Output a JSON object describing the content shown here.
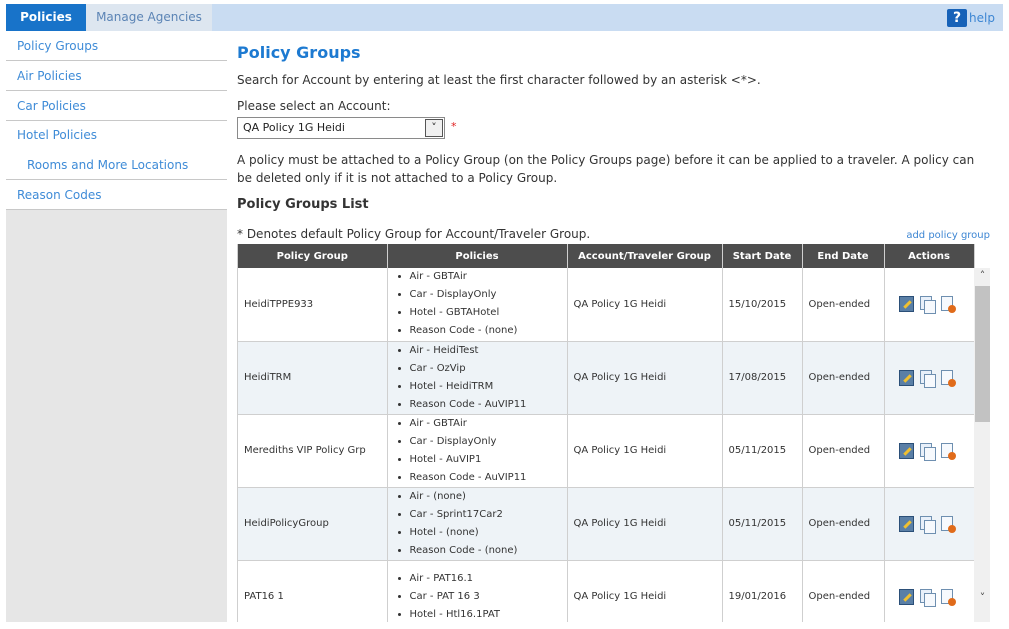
{
  "tabs": {
    "policies": "Policies",
    "manage_agencies": "Manage Agencies"
  },
  "help": {
    "label": "help",
    "icon": "?"
  },
  "sidebar": {
    "items": [
      {
        "label": "Policy Groups"
      },
      {
        "label": "Air Policies"
      },
      {
        "label": "Car Policies"
      },
      {
        "label": "Hotel Policies"
      },
      {
        "label": "Rooms and More Locations"
      },
      {
        "label": "Reason Codes"
      }
    ]
  },
  "main": {
    "title": "Policy Groups",
    "search_hint": "Search for Account by entering at least the first character followed by an asterisk <*>.",
    "account_label": "Please select an Account:",
    "account_value": "QA Policy 1G Heidi",
    "required_marker": "*",
    "policy_note": "A policy must be attached to a Policy Group (on the Policy Groups page) before it can be applied to a traveler. A policy can be deleted only if it is not attached to a Policy Group.",
    "list_title": "Policy Groups List",
    "default_note": "* Denotes default Policy Group for Account/Traveler Group.",
    "add_link": "add policy group"
  },
  "table": {
    "headers": [
      "Policy Group",
      "Policies",
      "Account/Traveler Group",
      "Start Date",
      "End Date",
      "Actions"
    ],
    "rows": [
      {
        "group": "HeidiTPPE933",
        "policies": [
          "Air - GBTAir",
          "Car - DisplayOnly",
          "Hotel - GBTAHotel",
          "Reason Code - (none)"
        ],
        "account": "QA Policy 1G Heidi",
        "start": "15/10/2015",
        "end": "Open-ended"
      },
      {
        "group": "HeidiTRM",
        "policies": [
          "Air - HeidiTest",
          "Car - OzVip",
          "Hotel - HeidiTRM",
          "Reason Code - AuVIP11"
        ],
        "account": "QA Policy 1G Heidi",
        "start": "17/08/2015",
        "end": "Open-ended"
      },
      {
        "group": "Merediths VIP Policy Grp",
        "policies": [
          "Air - GBTAir",
          "Car - DisplayOnly",
          "Hotel - AuVIP1",
          "Reason Code - AuVIP11"
        ],
        "account": "QA Policy 1G Heidi",
        "start": "05/11/2015",
        "end": "Open-ended"
      },
      {
        "group": "HeidiPolicyGroup",
        "policies": [
          "Air - (none)",
          "Car - Sprint17Car2",
          "Hotel - (none)",
          "Reason Code - (none)"
        ],
        "account": "QA Policy 1G Heidi",
        "start": "05/11/2015",
        "end": "Open-ended"
      },
      {
        "group": "PAT16 1",
        "policies": [
          "Air - PAT16.1",
          "Car - PAT 16 3",
          "Hotel - Htl16.1PAT"
        ],
        "account": "QA Policy 1G Heidi",
        "start": "19/01/2016",
        "end": "Open-ended"
      }
    ]
  },
  "colors": {
    "accent": "#1873c9",
    "link": "#3e8bd7",
    "header_bg": "#4d4d4d"
  }
}
